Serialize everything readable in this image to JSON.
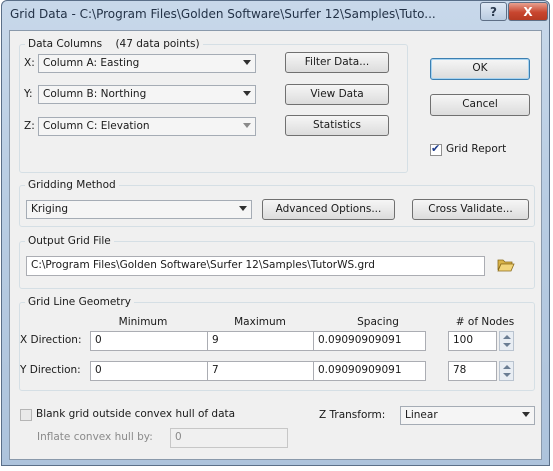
{
  "window": {
    "title": "Grid Data - C:\\Program Files\\Golden Software\\Surfer 12\\Samples\\Tuto...",
    "help_glyph": "?",
    "close_glyph": "X"
  },
  "data_columns": {
    "group_label": "Data Columns",
    "points_text": "(47 data points)",
    "x_label": "X:",
    "x_value": "Column A:  Easting",
    "y_label": "Y:",
    "y_value": "Column B:  Northing",
    "z_label": "Z:",
    "z_value": "Column C:  Elevation"
  },
  "buttons": {
    "filter_data": "Filter Data...",
    "view_data": "View Data",
    "statistics": "Statistics",
    "ok": "OK",
    "cancel": "Cancel",
    "advanced_options": "Advanced Options...",
    "cross_validate": "Cross Validate..."
  },
  "grid_report": {
    "label": "Grid Report",
    "checked": true
  },
  "gridding_method": {
    "group_label": "Gridding Method",
    "value": "Kriging"
  },
  "output_grid_file": {
    "group_label": "Output Grid File",
    "path": "C:\\Program Files\\Golden Software\\Surfer 12\\Samples\\TutorWS.grd"
  },
  "grid_line_geometry": {
    "group_label": "Grid Line Geometry",
    "col_minimum": "Minimum",
    "col_maximum": "Maximum",
    "col_spacing": "Spacing",
    "col_nodes": "# of Nodes",
    "x": {
      "label": "X Direction:",
      "minimum": "0",
      "maximum": "9",
      "spacing": "0.09090909091",
      "nodes": "100"
    },
    "y": {
      "label": "Y Direction:",
      "minimum": "0",
      "maximum": "7",
      "spacing": "0.09090909091",
      "nodes": "78"
    }
  },
  "blank_grid": {
    "label": "Blank grid outside convex hull of data",
    "checked": false,
    "inflate_label": "Inflate convex hull by:",
    "inflate_value": "0"
  },
  "z_transform": {
    "label": "Z Transform:",
    "value": "Linear"
  },
  "icons": {
    "browse": "folder-open-icon"
  }
}
